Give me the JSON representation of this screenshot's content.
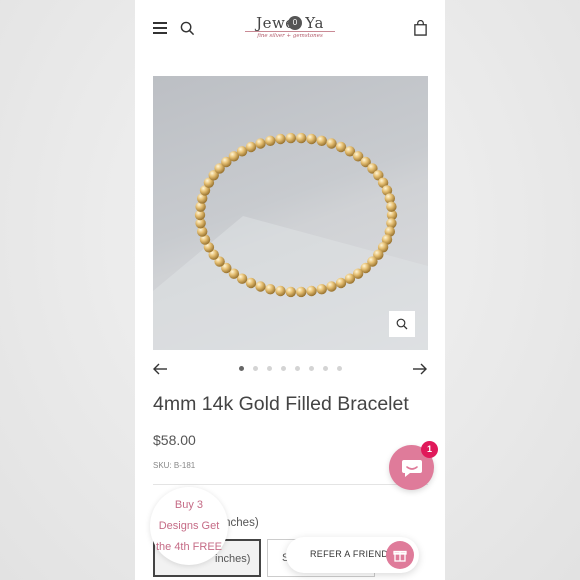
{
  "header": {
    "logo_text": "Jewel Ya",
    "logo_tagline": "fine silver + gemstones",
    "cart_count": "0"
  },
  "gallery": {
    "slides_total": 8,
    "active_slide": 1
  },
  "product": {
    "title": "4mm 14k Gold Filled Bracelet",
    "price": "$58.00",
    "sku": "SKU: B-181",
    "size_label_partial": "7 inches)",
    "size_option_1_partial": "inches)",
    "size_option_2_partial": "S"
  },
  "promo": {
    "line1": "Buy 3",
    "line2": "Designs Get",
    "line3": "the 4th FREE"
  },
  "chat": {
    "badge_count": "1"
  },
  "referral": {
    "label": "REFER A FRIEND"
  },
  "colors": {
    "accent_pink": "#df7b9a",
    "badge_red": "#e0195a",
    "logo_pink": "#b25a6a"
  }
}
